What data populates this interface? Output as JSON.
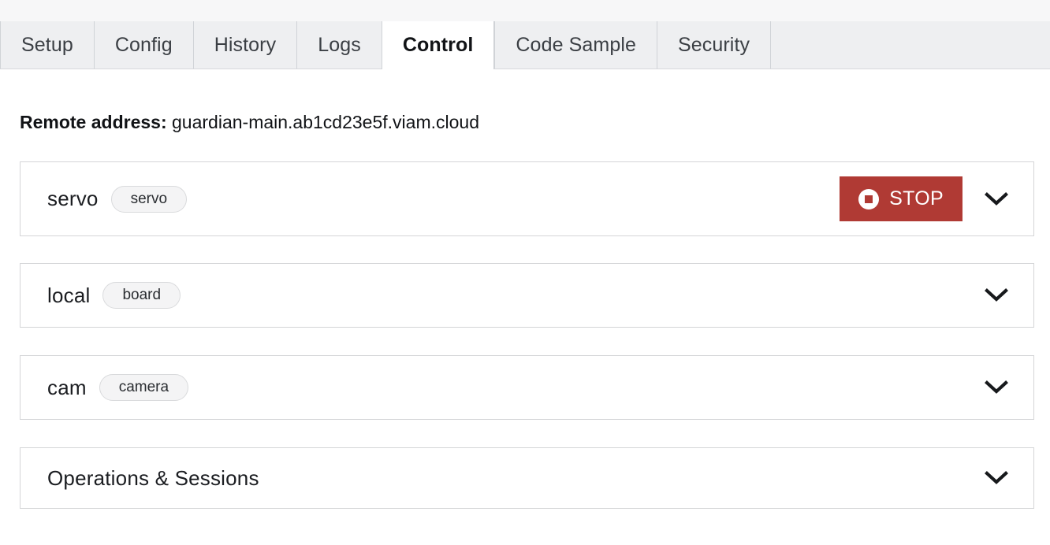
{
  "tabs": [
    {
      "label": "Setup",
      "active": false
    },
    {
      "label": "Config",
      "active": false
    },
    {
      "label": "History",
      "active": false
    },
    {
      "label": "Logs",
      "active": false
    },
    {
      "label": "Control",
      "active": true
    },
    {
      "label": "Code Sample",
      "active": false
    },
    {
      "label": "Security",
      "active": false
    }
  ],
  "remote": {
    "label": "Remote address:",
    "value": "guardian-main.ab1cd23e5f.viam.cloud"
  },
  "cards": [
    {
      "name": "servo",
      "type": "servo",
      "has_stop": true,
      "stop_label": "STOP",
      "chevron": "chevron-down-icon"
    },
    {
      "name": "local",
      "type": "board",
      "has_stop": false,
      "chevron": "chevron-down-icon"
    },
    {
      "name": "cam",
      "type": "camera",
      "has_stop": false,
      "chevron": "chevron-down-icon"
    }
  ],
  "operations_card": {
    "title": "Operations & Sessions",
    "chevron": "chevron-down-icon"
  },
  "colors": {
    "stop_red": "#b03a34",
    "tab_bar_bg": "#eeeff1",
    "card_border": "#d4d5d7",
    "pill_bg": "#f4f4f5"
  }
}
